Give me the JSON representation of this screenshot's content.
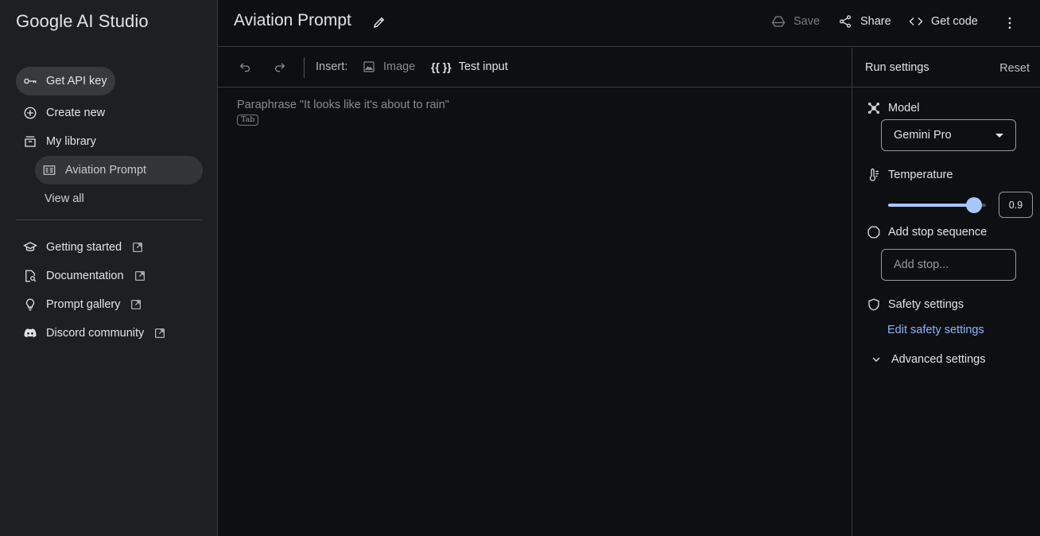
{
  "app": {
    "title": "Google AI Studio"
  },
  "sidebar": {
    "items": [
      {
        "label": "Get API key",
        "icon": "key-icon"
      },
      {
        "label": "Create new",
        "icon": "add-circle-icon"
      },
      {
        "label": "My library",
        "icon": "library-icon"
      },
      {
        "label": "Aviation Prompt",
        "icon": "prompt-icon"
      },
      {
        "label": "View all"
      }
    ],
    "links": [
      {
        "label": "Getting started",
        "icon": "graduation-cap-icon"
      },
      {
        "label": "Documentation",
        "icon": "document-search-icon"
      },
      {
        "label": "Prompt gallery",
        "icon": "lightbulb-icon"
      },
      {
        "label": "Discord community",
        "icon": "discord-icon"
      }
    ]
  },
  "header": {
    "title": "Aviation Prompt",
    "save_label": "Save",
    "share_label": "Share",
    "get_code_label": "Get code"
  },
  "toolbar": {
    "insert_label": "Insert:",
    "image_label": "Image",
    "test_input_symbol": "{{ }}",
    "test_input_label": "Test input"
  },
  "editor": {
    "placeholder": "Paraphrase \"It looks like it's about to rain\"",
    "tab_hint": "Tab"
  },
  "run_settings": {
    "title": "Run settings",
    "reset_label": "Reset",
    "model_label": "Model",
    "model_value": "Gemini Pro",
    "temperature_label": "Temperature",
    "temperature_value": "0.9",
    "temperature_fraction": 0.9,
    "stop_label": "Add stop sequence",
    "stop_placeholder": "Add stop...",
    "safety_label": "Safety settings",
    "edit_safety_label": "Edit safety settings",
    "advanced_label": "Advanced settings"
  },
  "colors": {
    "background": "#0e0f13",
    "sidebar": "#1e1f20",
    "accent": "#a8c7fa",
    "link": "#8ab4f8"
  }
}
